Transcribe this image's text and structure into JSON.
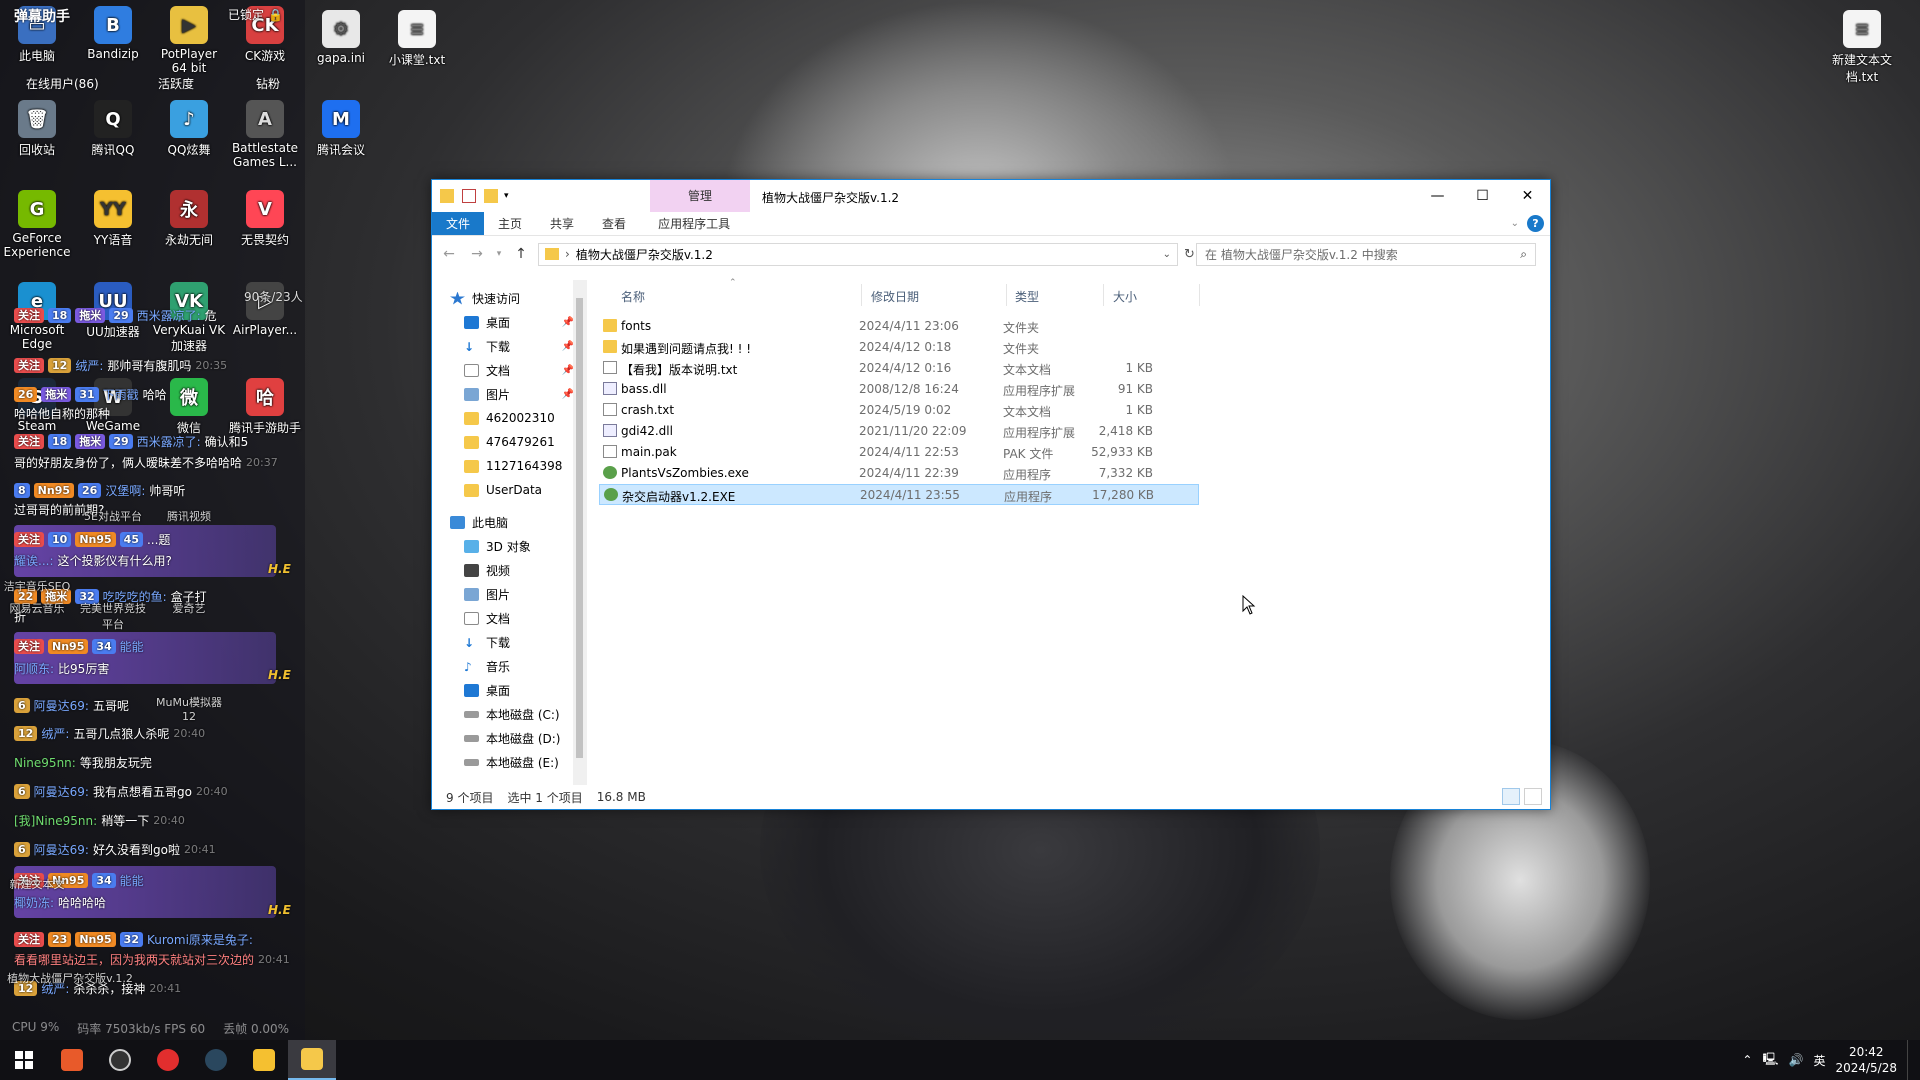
{
  "desktop": {
    "left_icons": [
      {
        "label": "此电脑"
      },
      {
        "label": "Bandizip"
      },
      {
        "label": "PotPlayer 64 bit"
      },
      {
        "label": "CK游戏"
      },
      {
        "label": "回收站"
      },
      {
        "label": "腾讯QQ"
      },
      {
        "label": "QQ炫舞"
      },
      {
        "label": "Battlestate Games L..."
      },
      {
        "label": "GeForce Experience"
      },
      {
        "label": "YY语音"
      },
      {
        "label": "永劫无间"
      },
      {
        "label": "无畏契约"
      },
      {
        "label": "Microsoft Edge"
      },
      {
        "label": "UU加速器"
      },
      {
        "label": "VeryKuai VK加速器"
      },
      {
        "label": "AirPlayer..."
      },
      {
        "label": "Steam"
      },
      {
        "label": "WeGame"
      },
      {
        "label": "微信"
      },
      {
        "label": "腾讯手游助手"
      },
      {
        "label": "洁宇音乐SEQ"
      },
      {
        "label": "5E对战平台"
      },
      {
        "label": "腾讯视频"
      },
      {
        "label": "网易云音乐"
      },
      {
        "label": "完美世界竞技平台"
      },
      {
        "label": "爱奇艺"
      },
      {
        "label": "MuMu模拟器12"
      },
      {
        "label": "新建文本文"
      },
      {
        "label": "植物大战僵尸杂交版v.1.2"
      }
    ],
    "top_icons": [
      {
        "label": "gapa.ini"
      },
      {
        "label": "小课堂.txt"
      },
      {
        "label": "腾讯会议"
      }
    ],
    "right_icon": {
      "label": "新建文本文档.txt"
    }
  },
  "chat": {
    "header": "弹幕助手",
    "online": "在线用户(86)",
    "activity": "活跃度",
    "diamond": "钻粉",
    "locked": "已锁定",
    "viewer_count": "90条/23人",
    "lines": [
      {
        "badge1": "关注",
        "badge2": "18",
        "badge3": "拖米",
        "badge4": "29",
        "name": "西米露凉了:",
        "text": "危"
      },
      {
        "badge1": "关注",
        "badge2": "12",
        "badge3": "绒严:",
        "name": "",
        "text": "那帅哥有腹肌吗",
        "time": "20:35"
      },
      {
        "badge1": "",
        "badge2": "26",
        "badge3": "拖米",
        "badge4": "31",
        "name": "下雨戳",
        "text": "哈哈"
      },
      {
        "badge1": "",
        "badge2": "",
        "badge3": "",
        "name": "哈哈他自称的那种",
        "text": ""
      },
      {
        "badge1": "关注",
        "badge2": "18",
        "badge3": "拖米",
        "badge4": "29",
        "name": "西米露凉了:",
        "text": "确认和5"
      },
      {
        "badge1": "",
        "badge2": "",
        "badge3": "",
        "name": "哥的好朋友身份了，俩人暧昧差不多哈哈哈",
        "text": "",
        "time": "20:37"
      },
      {
        "badge1": "",
        "badge2": "8",
        "badge3": "Nn95",
        "badge4": "26",
        "name": "汉堡啊:",
        "text": "帅哥听"
      },
      {
        "badge1": "",
        "badge2": "",
        "badge3": "",
        "name": "过哥哥的前前期?",
        "text": ""
      },
      {
        "badge1": "关注",
        "badge2": "10",
        "badge3": "Nn95",
        "badge4": "45",
        "name": "...",
        "text": "...题"
      },
      {
        "badge1": "",
        "badge2": "",
        "badge3": "",
        "name": "耀诶...:",
        "text": "这个投影仪有什么用?"
      },
      {
        "badge1": "",
        "badge2": "22",
        "badge3": "拖米",
        "badge4": "32",
        "name": "吃吃吃的鱼:",
        "text": "盒子打"
      },
      {
        "badge1": "",
        "badge2": "",
        "badge3": "",
        "name": "折",
        "text": ""
      },
      {
        "badge1": "关注",
        "badge2": "",
        "badge3": "Nn95",
        "badge4": "34",
        "name": "能能",
        "text": ""
      },
      {
        "badge1": "",
        "badge2": "",
        "badge3": "",
        "name": "阿顺东:",
        "text": "比95厉害"
      },
      {
        "badge1": "",
        "badge2": "6",
        "badge3": "阿曼达69:",
        "name": "",
        "text": "五哥呢"
      },
      {
        "badge1": "",
        "badge2": "12",
        "badge3": "绒严:",
        "name": "",
        "text": "五哥几点狼人杀呢",
        "time": "20:40"
      },
      {
        "badge1": "",
        "badge2": "",
        "badge3": "",
        "name": "Nine95nn:",
        "text": "等我朋友玩完"
      },
      {
        "badge1": "",
        "badge2": "6",
        "badge3": "阿曼达69:",
        "name": "",
        "text": "我有点想看五哥go",
        "time": "20:40"
      },
      {
        "badge1": "",
        "badge2": "",
        "badge3": "",
        "name": "[我]Nine95nn:",
        "text": "稍等一下",
        "time": "20:40"
      },
      {
        "badge1": "",
        "badge2": "6",
        "badge3": "阿曼达69:",
        "name": "",
        "text": "好久没看到go啦",
        "time": "20:41"
      },
      {
        "badge1": "关注",
        "badge2": "",
        "badge3": "Nn95",
        "badge4": "34",
        "name": "能能",
        "text": ""
      },
      {
        "badge1": "",
        "badge2": "",
        "badge3": "",
        "name": "椰奶冻:",
        "text": "哈哈哈哈"
      },
      {
        "badge1": "关注",
        "badge2": "23",
        "badge3": "Nn95",
        "badge4": "32",
        "name": "Kuromi原来是兔子:",
        "text": ""
      },
      {
        "badge1": "",
        "badge2": "",
        "badge3": "",
        "name": "看看哪里站边王，因为我两天就站对三次边的",
        "text": "",
        "time": "20:41"
      },
      {
        "badge1": "",
        "badge2": "12",
        "badge3": "绒严:",
        "name": "",
        "text": "杀杀杀，接神",
        "time": "20:41"
      }
    ],
    "card_tag": "H.E",
    "status": {
      "cpu": "CPU 9%",
      "bitrate": "码率 7503kb/s FPS 60",
      "drop": "丢帧 0.00%"
    }
  },
  "explorer": {
    "manage_tab": "管理",
    "title": "植物大战僵尸杂交版v.1.2",
    "ribbon_tabs": [
      "文件",
      "主页",
      "共享",
      "查看",
      "应用程序工具"
    ],
    "address_path": "植物大战僵尸杂交版v.1.2",
    "search_placeholder": "在 植物大战僵尸杂交版v.1.2 中搜索",
    "nav": [
      {
        "label": "快速访问",
        "icon": "star-icon",
        "head": true,
        "pin": false
      },
      {
        "label": "桌面",
        "icon": "desktop-icon",
        "head": false,
        "pin": true
      },
      {
        "label": "下载",
        "icon": "download-icon",
        "head": false,
        "pin": true
      },
      {
        "label": "文档",
        "icon": "documents-icon",
        "head": false,
        "pin": true
      },
      {
        "label": "图片",
        "icon": "pictures-icon",
        "head": false,
        "pin": true
      },
      {
        "label": "462002310",
        "icon": "folder-icon",
        "head": false,
        "pin": false
      },
      {
        "label": "476479261",
        "icon": "folder-icon",
        "head": false,
        "pin": false
      },
      {
        "label": "1127164398",
        "icon": "folder-icon",
        "head": false,
        "pin": false
      },
      {
        "label": "UserData",
        "icon": "folder-icon",
        "head": false,
        "pin": false
      },
      {
        "label": "此电脑",
        "icon": "pc-icon",
        "head": true,
        "pin": false
      },
      {
        "label": "3D 对象",
        "icon": "3d-objects-icon",
        "head": false,
        "pin": false
      },
      {
        "label": "视频",
        "icon": "videos-icon",
        "head": false,
        "pin": false
      },
      {
        "label": "图片",
        "icon": "pictures-icon",
        "head": false,
        "pin": false
      },
      {
        "label": "文档",
        "icon": "documents-icon",
        "head": false,
        "pin": false
      },
      {
        "label": "下载",
        "icon": "download-icon",
        "head": false,
        "pin": false
      },
      {
        "label": "音乐",
        "icon": "music-icon",
        "head": false,
        "pin": false
      },
      {
        "label": "桌面",
        "icon": "desktop-icon",
        "head": false,
        "pin": false
      },
      {
        "label": "本地磁盘 (C:)",
        "icon": "drive-icon",
        "head": false,
        "pin": false
      },
      {
        "label": "本地磁盘 (D:)",
        "icon": "drive-icon",
        "head": false,
        "pin": false
      },
      {
        "label": "本地磁盘 (E:)",
        "icon": "drive-icon",
        "head": false,
        "pin": false
      }
    ],
    "columns": {
      "name": "名称",
      "date": "修改日期",
      "type": "类型",
      "size": "大小"
    },
    "files": [
      {
        "name": "fonts",
        "date": "2024/4/11 23:06",
        "type": "文件夹",
        "size": "",
        "icon": "folder-icon",
        "selected": false
      },
      {
        "name": "如果遇到问题请点我! ! !",
        "date": "2024/4/12 0:18",
        "type": "文件夹",
        "size": "",
        "icon": "folder-icon",
        "selected": false
      },
      {
        "name": "【看我】版本说明.txt",
        "date": "2024/4/12 0:16",
        "type": "文本文档",
        "size": "1 KB",
        "icon": "text-file-icon",
        "selected": false
      },
      {
        "name": "bass.dll",
        "date": "2008/12/8 16:24",
        "type": "应用程序扩展",
        "size": "91 KB",
        "icon": "dll-file-icon",
        "selected": false
      },
      {
        "name": "crash.txt",
        "date": "2024/5/19 0:02",
        "type": "文本文档",
        "size": "1 KB",
        "icon": "text-file-icon",
        "selected": false
      },
      {
        "name": "gdi42.dll",
        "date": "2021/11/20 22:09",
        "type": "应用程序扩展",
        "size": "2,418 KB",
        "icon": "dll-file-icon",
        "selected": false
      },
      {
        "name": "main.pak",
        "date": "2024/4/11 22:53",
        "type": "PAK 文件",
        "size": "52,933 KB",
        "icon": "pak-file-icon",
        "selected": false
      },
      {
        "name": "PlantsVsZombies.exe",
        "date": "2024/4/11 22:39",
        "type": "应用程序",
        "size": "7,332 KB",
        "icon": "exe-file-icon",
        "selected": false
      },
      {
        "name": "杂交启动器v1.2.EXE",
        "date": "2024/4/11 23:55",
        "type": "应用程序",
        "size": "17,280 KB",
        "icon": "exe-file-icon",
        "selected": true
      }
    ],
    "status": {
      "count": "9 个项目",
      "selected": "选中 1 个项目",
      "size": "16.8 MB"
    }
  },
  "taskbar": {
    "apps": [
      "start-button",
      "app-1",
      "app-2",
      "netease-music",
      "steam",
      "yy",
      "file-explorer"
    ],
    "tray_lang": "英",
    "time": "20:42",
    "date": "2024/5/28"
  }
}
